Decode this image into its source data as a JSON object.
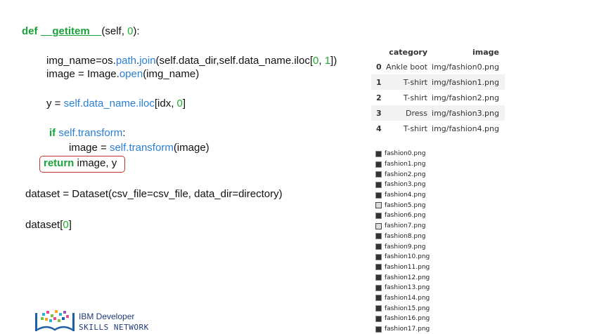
{
  "code": {
    "line1": {
      "kw": "def",
      "name": "__getitem__",
      "a": "(self, ",
      "n": "0",
      "b": "):"
    },
    "line2": {
      "a": "img_name=os.",
      "f1": "path",
      "b": ".",
      "f2": "join",
      "c": "(self.data_dir,self.data_name.iloc[",
      "n1": "0",
      "d": ", ",
      "n2": "1",
      "e": "])"
    },
    "line3": {
      "a": "image = Image.",
      "f": "open",
      "b": "(img_name)"
    },
    "line4": {
      "a": "y = ",
      "s": "self.data_name.iloc",
      "b": "[idx, ",
      "n": "0",
      "c": "]"
    },
    "line5": {
      "kw": "if",
      "s": " self.transform",
      "a": ":"
    },
    "line6": {
      "a": "image = ",
      "s": "self.transform",
      "b": "(image)"
    },
    "line7": {
      "kw": "return",
      "a": " image, y"
    },
    "line8": {
      "a": "dataset = Dataset(csv_file=csv_file, data_dir=directory)"
    },
    "line9": {
      "a": "dataset[",
      "n": "0",
      "b": "]"
    }
  },
  "table": {
    "headers": [
      "category",
      "image"
    ],
    "rows": [
      {
        "idx": "0",
        "category": "Ankle boot",
        "image": "img/fashion0.png"
      },
      {
        "idx": "1",
        "category": "T-shirt",
        "image": "img/fashion1.png"
      },
      {
        "idx": "2",
        "category": "T-shirt",
        "image": "img/fashion2.png"
      },
      {
        "idx": "3",
        "category": "Dress",
        "image": "img/fashion3.png"
      },
      {
        "idx": "4",
        "category": "T-shirt",
        "image": "img/fashion4.png"
      }
    ]
  },
  "files": [
    "fashion0.png",
    "fashion1.png",
    "fashion2.png",
    "fashion3.png",
    "fashion4.png",
    "fashion5.png",
    "fashion6.png",
    "fashion7.png",
    "fashion8.png",
    "fashion9.png",
    "fashion10.png",
    "fashion11.png",
    "fashion12.png",
    "fashion13.png",
    "fashion14.png",
    "fashion15.png",
    "fashion16.png",
    "fashion17.png"
  ],
  "brand": {
    "line1": "IBM Developer",
    "line2": "SKILLS NETWORK"
  }
}
